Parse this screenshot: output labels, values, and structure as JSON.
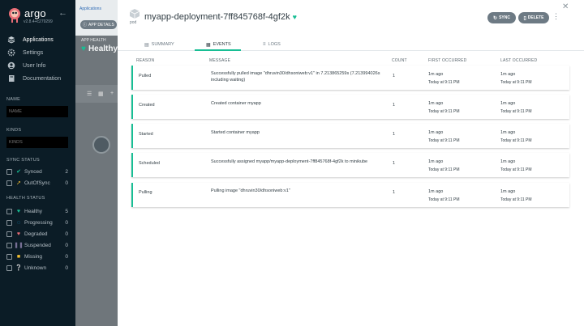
{
  "sidebar": {
    "brand": "argo",
    "version": "v2.8.4+c279299",
    "nav": [
      {
        "label": "Applications",
        "icon": "layers-icon",
        "active": true
      },
      {
        "label": "Settings",
        "icon": "gear-icon"
      },
      {
        "label": "User Info",
        "icon": "user-icon"
      },
      {
        "label": "Documentation",
        "icon": "book-icon"
      }
    ],
    "name_section": "NAME",
    "name_placeholder": "NAME",
    "kinds_section": "KINDS",
    "kinds_placeholder": "KINDS",
    "sync_section": "SYNC STATUS",
    "sync_status": [
      {
        "label": "Synced",
        "count": "2",
        "icon": "check-circle-icon",
        "color": "#18be94"
      },
      {
        "label": "OutOfSync",
        "count": "0",
        "icon": "arrow-up-circle-icon",
        "color": "#f4c030"
      }
    ],
    "health_section": "HEALTH STATUS",
    "health_status": [
      {
        "label": "Healthy",
        "count": "5",
        "icon": "heart-icon",
        "color": "#18be94"
      },
      {
        "label": "Progressing",
        "count": "0",
        "icon": "spinner-icon",
        "color": "#0dadea"
      },
      {
        "label": "Degraded",
        "count": "0",
        "icon": "broken-heart-icon",
        "color": "#e96d76"
      },
      {
        "label": "Suspended",
        "count": "0",
        "icon": "pause-icon",
        "color": "#766f94"
      },
      {
        "label": "Missing",
        "count": "0",
        "icon": "ghost-icon",
        "color": "#f4c030"
      },
      {
        "label": "Unknown",
        "count": "0",
        "icon": "question-circle-icon",
        "color": "#ccd6dd"
      }
    ]
  },
  "background": {
    "breadcrumb": "Applications",
    "app_details_label": "APP DETAILS",
    "app_health_label": "APP HEALTH",
    "app_health_value": "Healthy"
  },
  "panel": {
    "kind_label": "pod",
    "title": "myapp-deployment-7ff845768f-4gf2k",
    "sync_label": "SYNC",
    "delete_label": "DELETE",
    "tabs": [
      {
        "label": "SUMMARY",
        "icon": "doc-icon",
        "active": false
      },
      {
        "label": "EVENTS",
        "icon": "calendar-icon",
        "active": true
      },
      {
        "label": "LOGS",
        "icon": "lines-icon",
        "active": false
      }
    ],
    "columns": {
      "reason": "REASON",
      "message": "MESSAGE",
      "count": "COUNT",
      "first": "FIRST OCCURRED",
      "last": "LAST OCCURRED"
    },
    "events": [
      {
        "reason": "Pulled",
        "message": "Successfully pulled image \"dhruvin30/dhsoniweb:v1\" in 7.213865259s (7.213994026s including waiting)",
        "count": "1",
        "first": "1m ago",
        "first_sub": "Today at 9:11 PM",
        "last": "1m ago",
        "last_sub": "Today at 9:11 PM"
      },
      {
        "reason": "Created",
        "message": "Created container myapp",
        "count": "1",
        "first": "1m ago",
        "first_sub": "Today at 9:11 PM",
        "last": "1m ago",
        "last_sub": "Today at 9:11 PM"
      },
      {
        "reason": "Started",
        "message": "Started container myapp",
        "count": "1",
        "first": "1m ago",
        "first_sub": "Today at 9:11 PM",
        "last": "1m ago",
        "last_sub": "Today at 9:11 PM"
      },
      {
        "reason": "Scheduled",
        "message": "Successfully assigned myapp/myapp-deployment-7ff845768f-4gf2k to minikube",
        "count": "1",
        "first": "1m ago",
        "first_sub": "Today at 9:11 PM",
        "last": "1m ago",
        "last_sub": "Today at 9:11 PM"
      },
      {
        "reason": "Pulling",
        "message": "Pulling image \"dhruvin30/dhsoniweb:v1\"",
        "count": "1",
        "first": "1m ago",
        "first_sub": "Today at 9:11 PM",
        "last": "1m ago",
        "last_sub": "Today at 9:11 PM"
      }
    ]
  }
}
